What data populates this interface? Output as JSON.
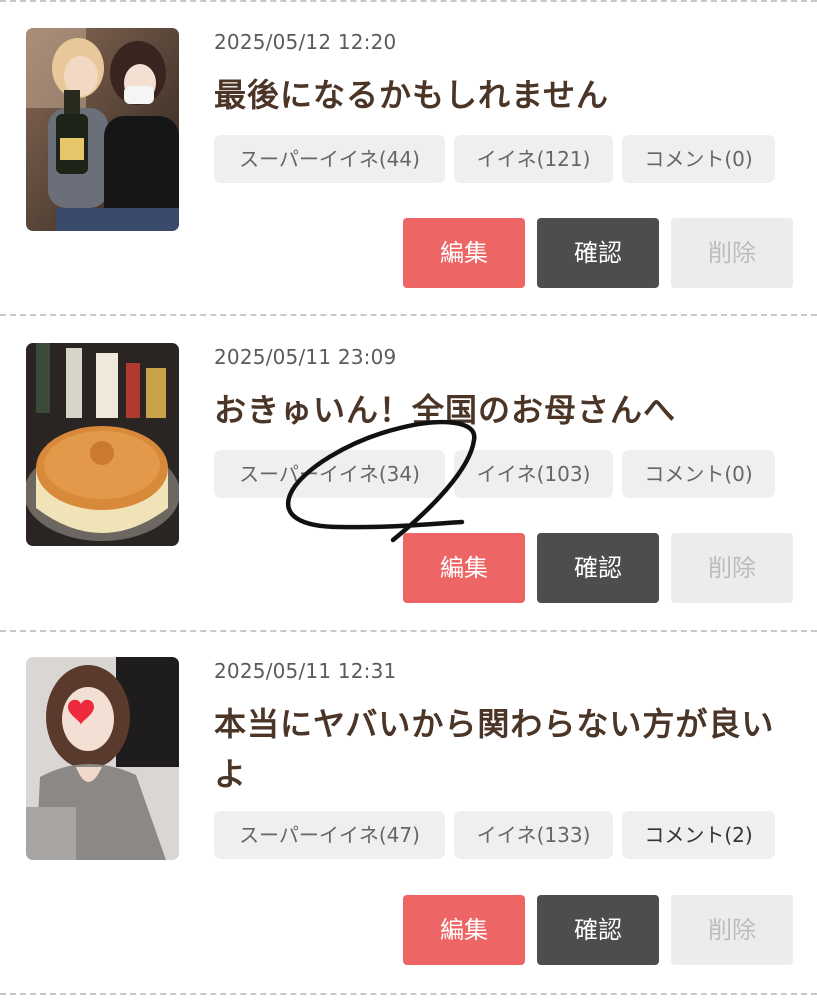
{
  "posts": [
    {
      "thumbnail": "two-women-holding-champagne-photo",
      "date": "2025/05/12 12:20",
      "title": "最後になるかもしれません",
      "super_like": "スーパーイイネ(44)",
      "like": "イイネ(121)",
      "comment": "コメント(0)",
      "edit": "編集",
      "confirm": "確認",
      "delete": "削除"
    },
    {
      "thumbnail": "cheesecake-photo",
      "date": "2025/05/11 23:09",
      "title": "おきゅいん！全国のお母さんへ",
      "super_like": "スーパーイイネ(34)",
      "like": "イイネ(103)",
      "comment": "コメント(0)",
      "edit": "編集",
      "confirm": "確認",
      "delete": "削除"
    },
    {
      "thumbnail": "selfie-with-heart-sticker-photo",
      "date": "2025/05/11 12:31",
      "title": "本当にヤバいから関わらない方が良いよ",
      "super_like": "スーパーイイネ(47)",
      "like": "イイネ(133)",
      "comment": "コメント(2)",
      "edit": "編集",
      "confirm": "確認",
      "delete": "削除"
    }
  ],
  "colors": {
    "edit_button": "#ee6565",
    "confirm_button": "#4d4d4d",
    "delete_button": "#ececec",
    "title_text": "#4a3527",
    "tag_background": "#efefef"
  },
  "annotation": "hand-drawn-black-scribble-over-second-post"
}
